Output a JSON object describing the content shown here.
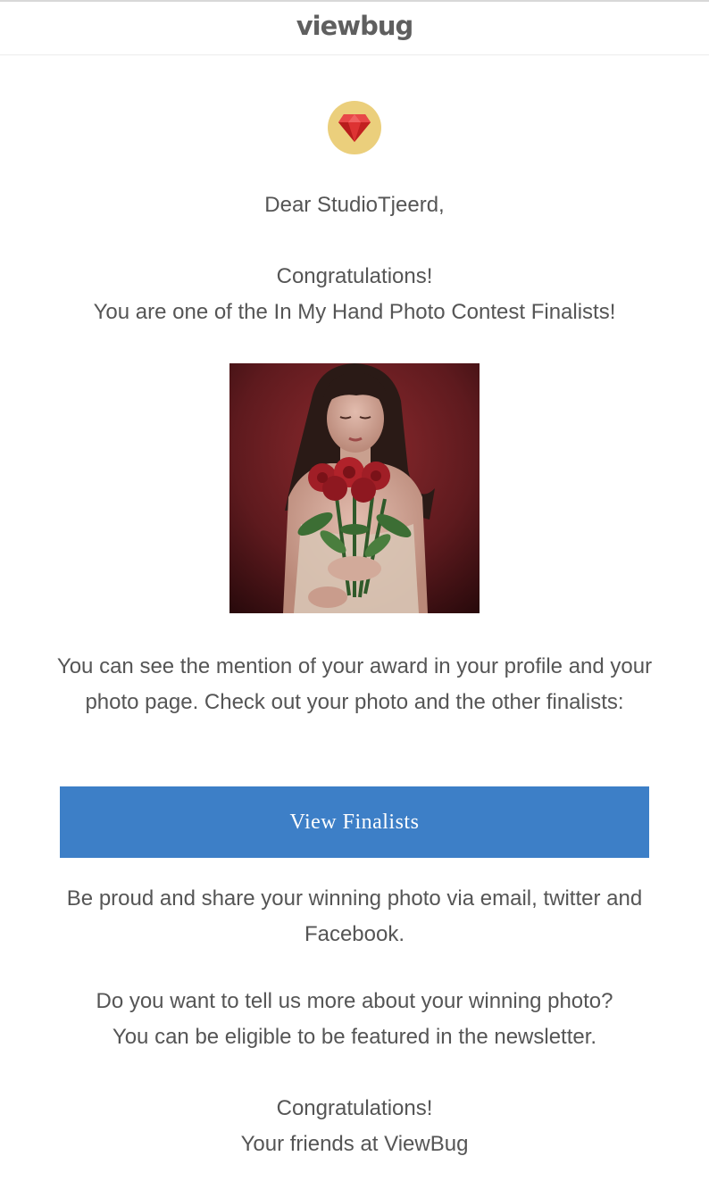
{
  "brand": {
    "logo_text": "viewbug"
  },
  "badge": {
    "icon": "ruby-gem-icon",
    "background": "#ebcf7c",
    "gem_color": "#d42a2a"
  },
  "greeting": "Dear StudioTjeerd,",
  "congrats": {
    "line1": "Congratulations!",
    "line2": "You are one of the In My Hand Photo Contest Finalists!"
  },
  "photo": {
    "subject": "finalist-photo"
  },
  "award_text": "You can see the mention of your award in your profile and your photo page. Check out your photo and the other finalists:",
  "cta": {
    "label": "View Finalists",
    "color": "#3d7fc7"
  },
  "share_text": "Be proud and share your winning photo via email, twitter and Facebook.",
  "tell_us": {
    "line1": "Do you want to tell us more about your winning photo?",
    "line2": "You can be eligible to be featured in the newsletter."
  },
  "signoff": {
    "line1": "Congratulations!",
    "line2": "Your friends at ViewBug"
  }
}
